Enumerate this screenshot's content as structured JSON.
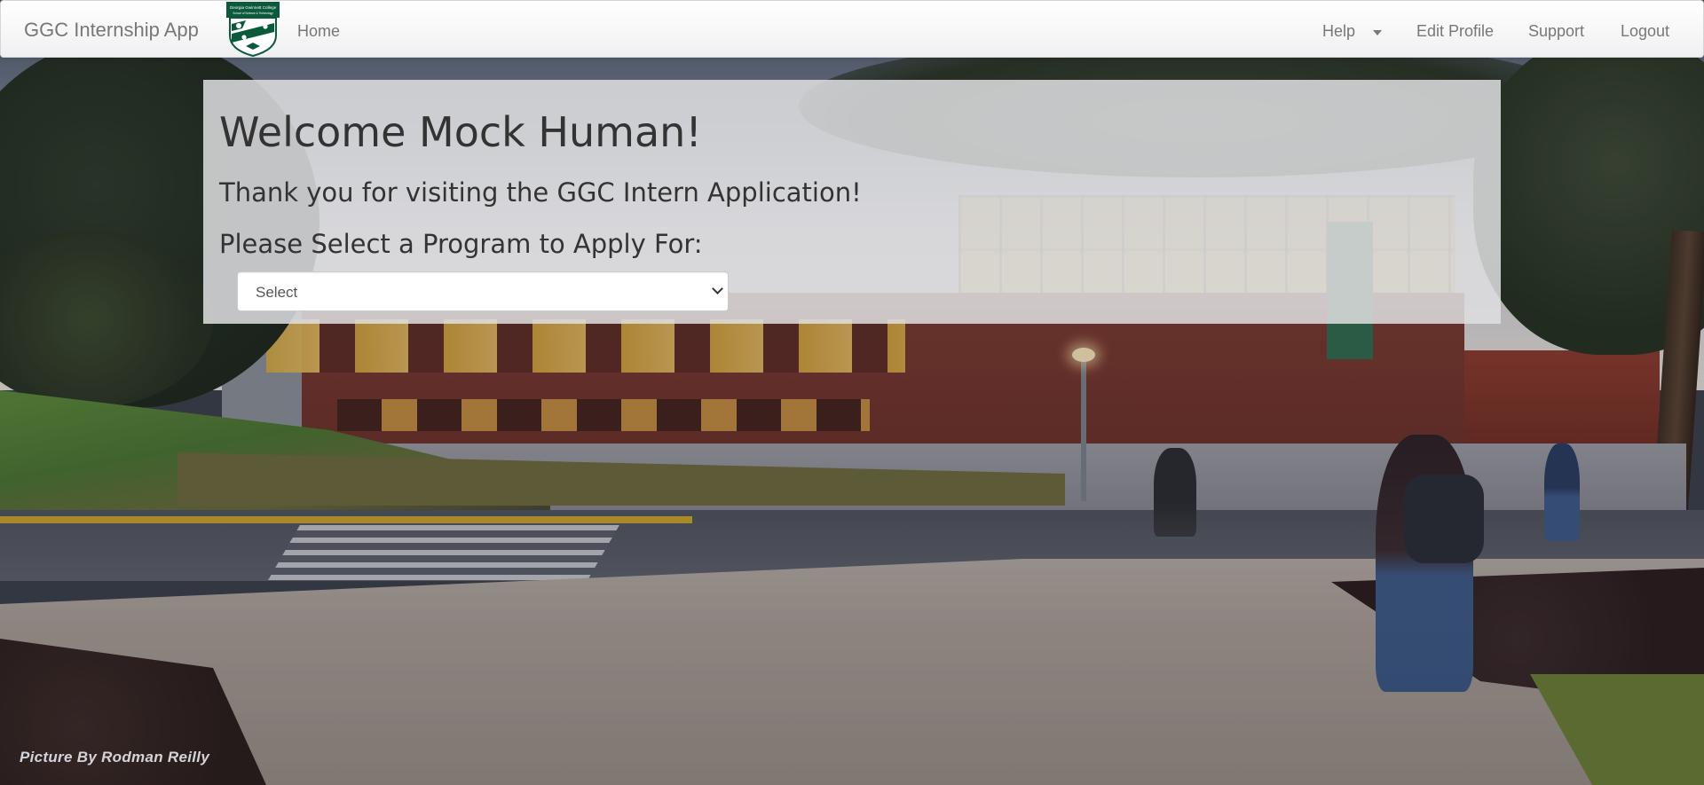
{
  "navbar": {
    "brand": "GGC Internship App",
    "logo_caption": "Georgia Gwinnett College",
    "logo_subcaption": "School of Science & Technology",
    "home": "Home",
    "help": "Help",
    "edit_profile": "Edit Profile",
    "support": "Support",
    "logout": "Logout"
  },
  "main": {
    "welcome": "Welcome Mock Human!",
    "thanks": "Thank you for visiting the GGC Intern Application!",
    "select_label": "Please Select a Program to Apply For:",
    "program_select_value": "Select"
  },
  "background": {
    "credit": "Picture By Rodman Reilly"
  },
  "colors": {
    "ggc_green": "#0b5a3c",
    "nav_text": "#777777",
    "heading_text": "#333333"
  }
}
